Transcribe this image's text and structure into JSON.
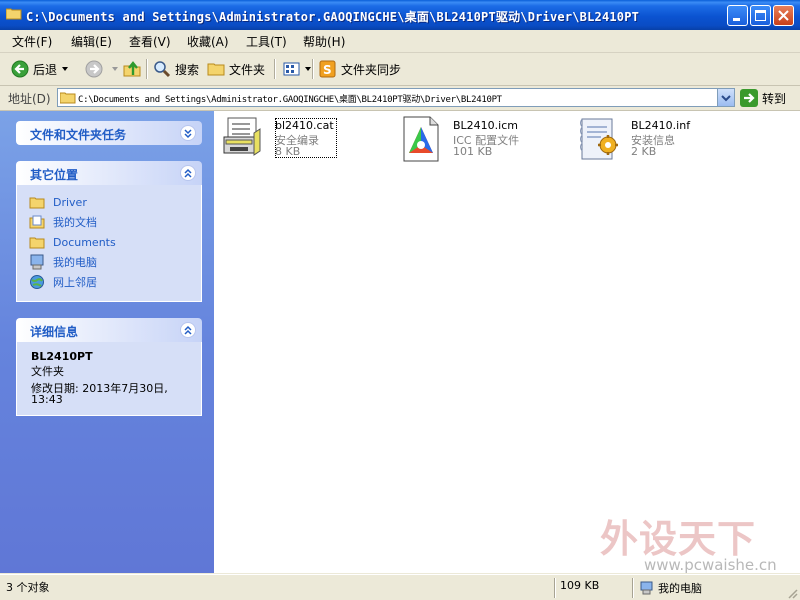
{
  "window": {
    "title": "C:\\Documents and Settings\\Administrator.GAOQINGCHE\\桌面\\BL2410PT驱动\\Driver\\BL2410PT"
  },
  "menu": {
    "items": [
      "文件(F)",
      "编辑(E)",
      "查看(V)",
      "收藏(A)",
      "工具(T)",
      "帮助(H)"
    ]
  },
  "toolbar": {
    "back_label": "后退",
    "search_label": "搜索",
    "folders_label": "文件夹",
    "sync_label": "文件夹同步"
  },
  "address": {
    "label": "地址(D)",
    "value": "C:\\Documents and Settings\\Administrator.GAOQINGCHE\\桌面\\BL2410PT驱动\\Driver\\BL2410PT",
    "go_label": "转到"
  },
  "taskpane": {
    "tasks_title": "文件和文件夹任务",
    "places_title": "其它位置",
    "places": [
      "Driver",
      "我的文档",
      "Documents",
      "我的电脑",
      "网上邻居"
    ],
    "details_title": "详细信息",
    "details_name": "BL2410PT",
    "details_type": "文件夹",
    "details_modified_line1": "修改日期: 2013年7月30日,",
    "details_modified_line2": "13:43"
  },
  "files": [
    {
      "name": "bl2410.cat",
      "type": "安全编录",
      "size": "8 KB",
      "icon": "catalog-icon"
    },
    {
      "name": "BL2410.icm",
      "type": "ICC 配置文件",
      "size": "101 KB",
      "icon": "icc-profile-icon"
    },
    {
      "name": "BL2410.inf",
      "type": "安装信息",
      "size": "2 KB",
      "icon": "setup-info-icon"
    }
  ],
  "watermark": {
    "big": "外设天下",
    "small": "www.pcwaishe.cn"
  },
  "status": {
    "objects": "3 个对象",
    "size": "109 KB",
    "location": "我的电脑"
  }
}
